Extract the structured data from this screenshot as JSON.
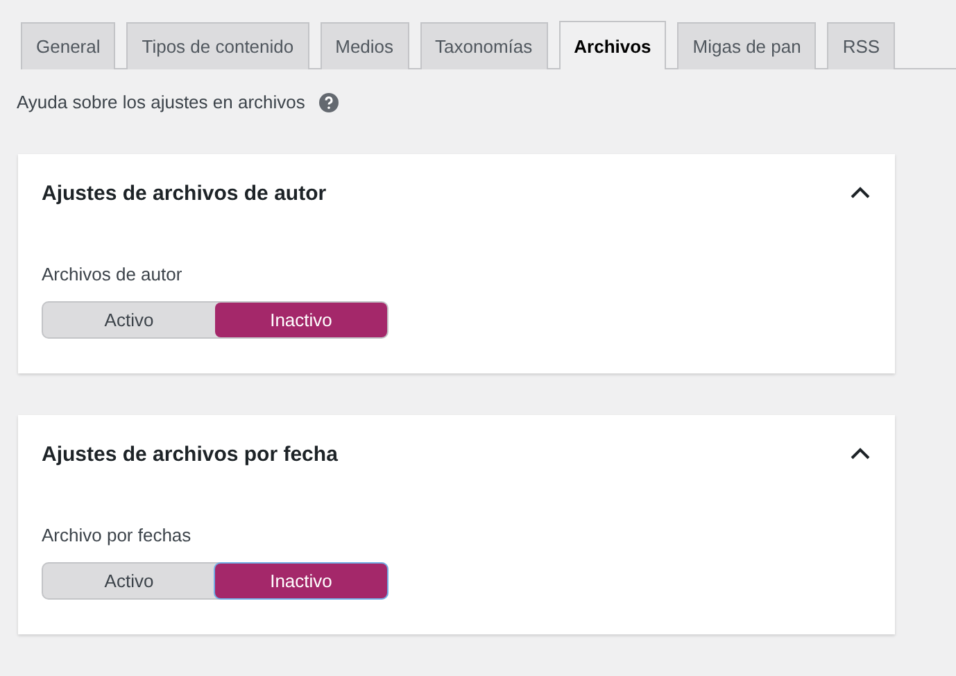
{
  "tabs": [
    {
      "label": "General",
      "selected": false
    },
    {
      "label": "Tipos de contenido",
      "selected": false
    },
    {
      "label": "Medios",
      "selected": false
    },
    {
      "label": "Taxonomías",
      "selected": false
    },
    {
      "label": "Archivos",
      "selected": true
    },
    {
      "label": "Migas de pan",
      "selected": false
    },
    {
      "label": "RSS",
      "selected": false
    }
  ],
  "help": {
    "text": "Ayuda sobre los ajustes en archivos"
  },
  "sections": [
    {
      "title": "Ajustes de archivos de autor",
      "expanded": true,
      "field_label": "Archivos de autor",
      "focused": false,
      "options": [
        {
          "label": "Activo",
          "selected": false
        },
        {
          "label": "Inactivo",
          "selected": true
        }
      ]
    },
    {
      "title": "Ajustes de archivos por fecha",
      "expanded": true,
      "field_label": "Archivo por fechas",
      "focused": true,
      "options": [
        {
          "label": "Activo",
          "selected": false
        },
        {
          "label": "Inactivo",
          "selected": true
        }
      ]
    }
  ]
}
